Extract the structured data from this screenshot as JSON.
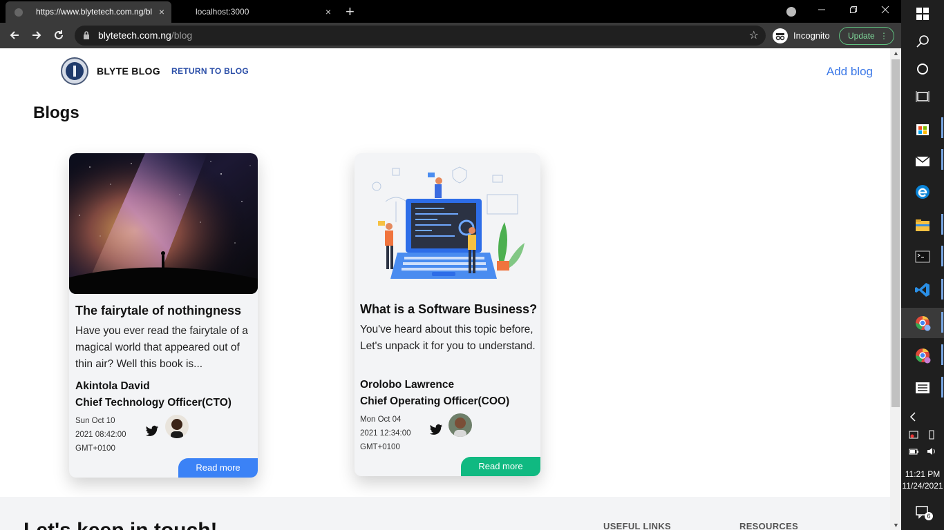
{
  "browser": {
    "tabs": [
      {
        "title": "https://www.blytetech.com.ng/bl"
      },
      {
        "title": "localhost:3000"
      }
    ],
    "new_tab_symbol": "+",
    "close_symbol": "×",
    "url_host": "blytetech.com.ng",
    "url_path": "/blog",
    "incognito_label": "Incognito",
    "update_label": "Update",
    "window_buttons": [
      "minimize",
      "restore",
      "close"
    ]
  },
  "site": {
    "brand": "BLYTE BLOG",
    "return_link": "RETURN TO BLOG",
    "add_blog": "Add blog",
    "page_title": "Blogs"
  },
  "posts": [
    {
      "title": "The fairytale of nothingness",
      "excerpt": "Have you ever read the fairytale of a magical world that appeared out of thin air? Well this book is...",
      "author": "Akintola David",
      "role": "Chief Technology Officer(CTO)",
      "date_line1": "Sun Oct 10",
      "date_line2": "2021 08:42:00",
      "date_line3": "GMT+0100",
      "read_more": "Read more",
      "image": "galaxy-night-sky",
      "button_color": "#3b82f6"
    },
    {
      "title": "What is a Software Business?",
      "excerpt": "You've heard about this topic before, Let's unpack it for you to understand.",
      "author": "Orolobo Lawrence",
      "role": "Chief Operating Officer(COO)",
      "date_line1": "Mon Oct 04",
      "date_line2": "2021 12:34:00",
      "date_line3": "GMT+0100",
      "read_more": "Read more",
      "image": "laptop-team-illustration",
      "button_color": "#10b981"
    }
  ],
  "footer": {
    "headline": "Let's keep in touch!",
    "col1": "USEFUL LINKS",
    "col2": "RESOURCES"
  },
  "taskbar": {
    "time": "11:21 PM",
    "date": "11/24/2021",
    "notification_count": "6",
    "icons": [
      "windows-start-icon",
      "search-icon",
      "cortana-icon",
      "task-view-icon",
      "store-icon",
      "mail-icon",
      "edge-icon",
      "file-explorer-icon",
      "terminal-icon",
      "vscode-icon",
      "chrome-profile-a-icon",
      "chrome-profile-b-icon",
      "news-icon"
    ]
  }
}
